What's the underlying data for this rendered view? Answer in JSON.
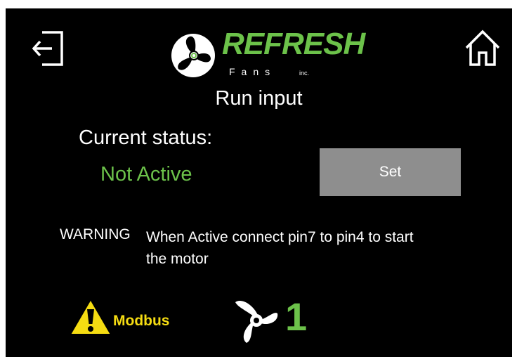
{
  "header": {
    "logo_word": "REFRESH",
    "logo_sub": "Fans",
    "logo_inc": "inc.",
    "exit_icon": "exit-icon",
    "home_icon": "home-icon"
  },
  "page": {
    "title": "Run input",
    "status_label": "Current status:",
    "status_value": "Not Active",
    "set_label": "Set",
    "warning_label": "WARNING",
    "warning_text": "When Active connect pin7 to pin4 to start the motor"
  },
  "footer": {
    "modbus_label": "Modbus",
    "fan_number": "1",
    "warning_icon": "warning-icon",
    "fan_icon": "fan-icon"
  },
  "colors": {
    "background": "#000000",
    "accent_green": "#6cc24a",
    "button_gray": "#8e8e8e",
    "warning_yellow": "#f5dc12"
  }
}
